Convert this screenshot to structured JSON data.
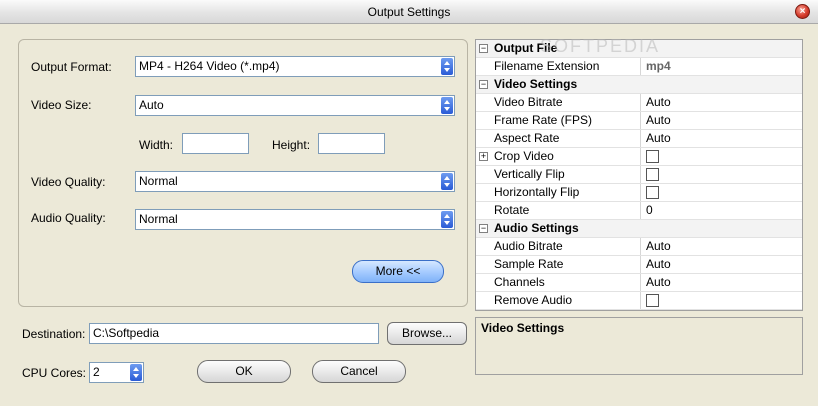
{
  "window": {
    "title": "Output Settings",
    "close_glyph": "×"
  },
  "form": {
    "output_format": {
      "label": "Output Format:",
      "value": "MP4 - H264 Video (*.mp4)"
    },
    "video_size": {
      "label": "Video Size:",
      "value": "Auto"
    },
    "width": {
      "label": "Width:",
      "value": ""
    },
    "height": {
      "label": "Height:",
      "value": ""
    },
    "video_quality": {
      "label": "Video Quality:",
      "value": "Normal"
    },
    "audio_quality": {
      "label": "Audio Quality:",
      "value": "Normal"
    },
    "more_label": "More <<"
  },
  "destination": {
    "label": "Destination:",
    "value": "C:\\Softpedia",
    "browse_label": "Browse..."
  },
  "cpu": {
    "label": "CPU Cores:",
    "value": "2"
  },
  "actions": {
    "ok_label": "OK",
    "cancel_label": "Cancel"
  },
  "properties": [
    {
      "kind": "category",
      "name": "Output File"
    },
    {
      "kind": "item",
      "name": "Filename Extension",
      "value": "mp4",
      "muted": true
    },
    {
      "kind": "category",
      "name": "Video Settings"
    },
    {
      "kind": "item",
      "name": "Video Bitrate",
      "value": "Auto"
    },
    {
      "kind": "item",
      "name": "Frame Rate (FPS)",
      "value": "Auto"
    },
    {
      "kind": "item",
      "name": "Aspect Rate",
      "value": "Auto"
    },
    {
      "kind": "item",
      "name": "Crop Video",
      "checkbox": true,
      "checked": false,
      "expandable": true
    },
    {
      "kind": "item",
      "name": "Vertically Flip",
      "checkbox": true,
      "checked": false
    },
    {
      "kind": "item",
      "name": "Horizontally Flip",
      "checkbox": true,
      "checked": false
    },
    {
      "kind": "item",
      "name": "Rotate",
      "value": "0"
    },
    {
      "kind": "category",
      "name": "Audio Settings"
    },
    {
      "kind": "item",
      "name": "Audio Bitrate",
      "value": "Auto"
    },
    {
      "kind": "item",
      "name": "Sample Rate",
      "value": "Auto"
    },
    {
      "kind": "item",
      "name": "Channels",
      "value": "Auto"
    },
    {
      "kind": "item",
      "name": "Remove Audio",
      "checkbox": true,
      "checked": false
    }
  ],
  "description": {
    "title": "Video Settings"
  },
  "watermark": "SOFTPEDIA"
}
